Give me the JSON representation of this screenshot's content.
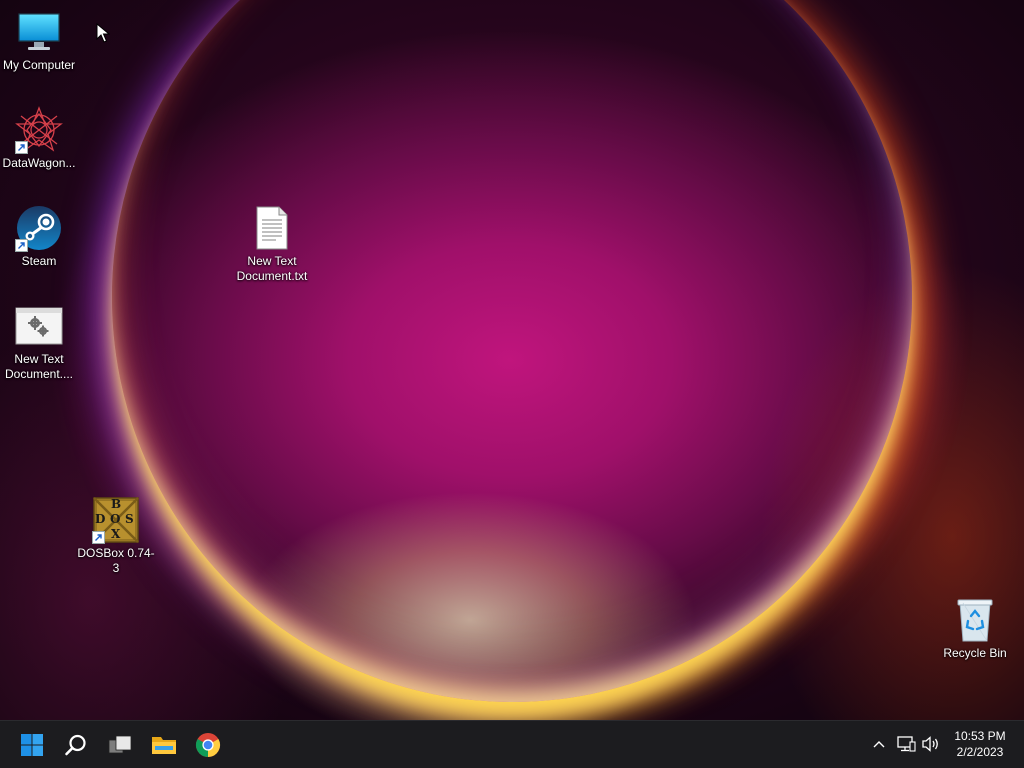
{
  "desktop": {
    "icons": [
      {
        "label": "My Computer",
        "icon": "monitor-icon"
      },
      {
        "label": "DataWagon...",
        "icon": "star-knot-icon",
        "shortcut": true
      },
      {
        "label": "Steam",
        "icon": "steam-icon",
        "shortcut": true
      },
      {
        "label": "New Text Document....",
        "icon": "settings-window-icon"
      },
      {
        "label": "New Text Document.txt",
        "icon": "text-file-icon"
      },
      {
        "label": "DOSBox 0.74-3",
        "icon": "dosbox-icon",
        "shortcut": true
      },
      {
        "label": "Recycle Bin",
        "icon": "recycle-bin-icon"
      }
    ],
    "dosbox_letters": [
      "B",
      "D",
      "O",
      "S",
      "X"
    ]
  },
  "taskbar": {
    "buttons": [
      "windows-start-icon",
      "search-icon",
      "task-view-icon",
      "file-explorer-icon",
      "chrome-icon"
    ],
    "tray": [
      "chevron-up-icon",
      "network-icon",
      "volume-icon"
    ],
    "clock": {
      "time": "10:53 PM",
      "date": "2/2/2023"
    }
  },
  "colors": {
    "taskbar": "#1c1c1f",
    "start_blue": "#1e90e6",
    "wallpaper_magenta": "#c0157d"
  }
}
